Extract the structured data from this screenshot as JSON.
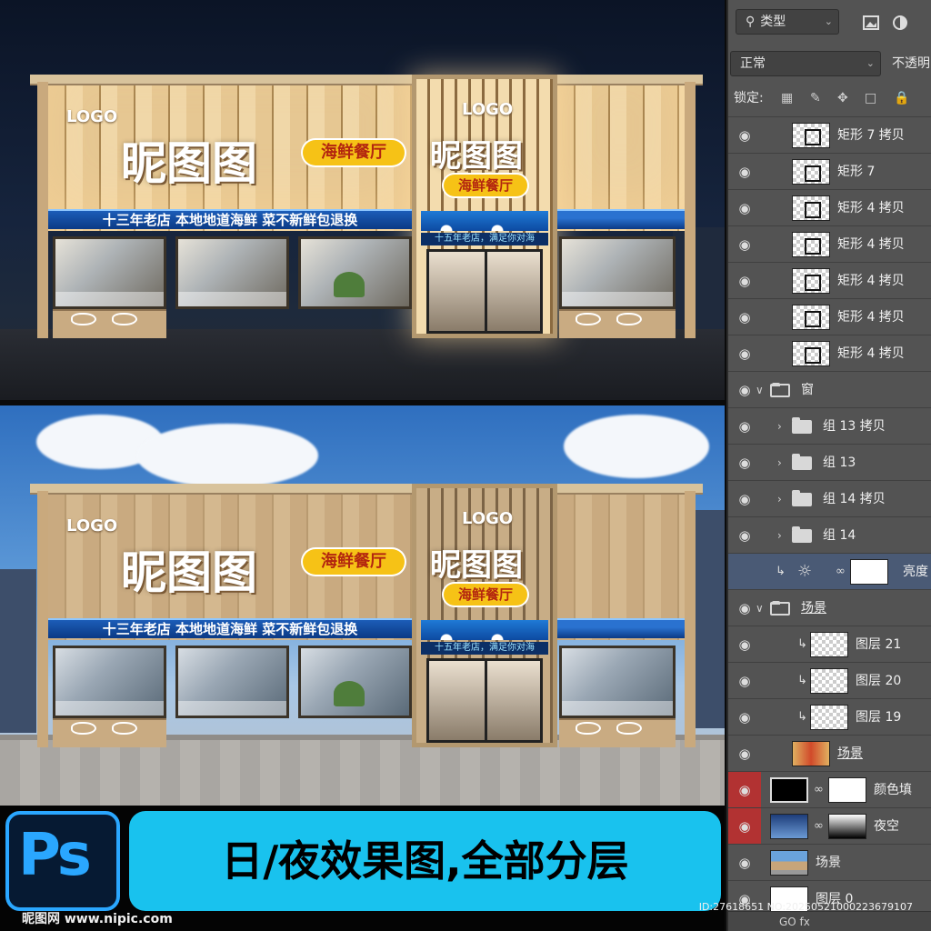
{
  "scenes": {
    "night": {
      "logo_left": "LOGO",
      "logo_center": "LOGO",
      "brand": "昵图图",
      "tag": "海鲜餐厅",
      "banner": "十三年老店  本地地道海鲜  菜不新鲜包退换",
      "center_ticker": "十五年老店，满足你对海"
    },
    "day": {
      "logo_left": "LOGO",
      "logo_center": "LOGO",
      "brand": "昵图图",
      "tag": "海鲜餐厅",
      "banner": "十三年老店  本地地道海鲜  菜不新鲜包退换",
      "center_ticker": "十五年老店，满足你对海"
    }
  },
  "layers_panel": {
    "filter": {
      "label": "类型",
      "icon": "search-icon"
    },
    "blend_mode": "正常",
    "opacity_label": "不透明",
    "lock_label": "锁定:",
    "layers": [
      {
        "name": "矩形 7 拷贝",
        "type": "shape"
      },
      {
        "name": "矩形 7",
        "type": "shape"
      },
      {
        "name": "矩形 4 拷贝",
        "type": "shape"
      },
      {
        "name": "矩形 4 拷贝",
        "type": "shape"
      },
      {
        "name": "矩形 4 拷贝",
        "type": "shape"
      },
      {
        "name": "矩形 4 拷贝",
        "type": "shape"
      },
      {
        "name": "矩形 4 拷贝",
        "type": "shape"
      },
      {
        "name": "窗",
        "type": "group-open"
      },
      {
        "name": "组 13 拷贝",
        "type": "group"
      },
      {
        "name": "组 13",
        "type": "group"
      },
      {
        "name": "组 14 拷贝",
        "type": "group"
      },
      {
        "name": "组 14",
        "type": "group"
      },
      {
        "name": "亮度",
        "type": "adjustment"
      },
      {
        "name": "场景",
        "type": "group-open"
      },
      {
        "name": "图层 21",
        "type": "clipped"
      },
      {
        "name": "图层 20",
        "type": "clipped"
      },
      {
        "name": "图层 19",
        "type": "clipped"
      },
      {
        "name": "场景",
        "type": "smart"
      },
      {
        "name": "颜色填",
        "type": "fill"
      },
      {
        "name": "夜空",
        "type": "gradient"
      },
      {
        "name": "场景",
        "type": "image"
      },
      {
        "name": "图层 0",
        "type": "image"
      }
    ],
    "bottom_icons": "GO  fx"
  },
  "footer": {
    "ps_logo": "Ps",
    "caption": "日/夜效果图,全部分层",
    "watermark": "昵图网 www.nipic.com",
    "image_id": "ID:27618651 NO:20250521000223679107"
  }
}
